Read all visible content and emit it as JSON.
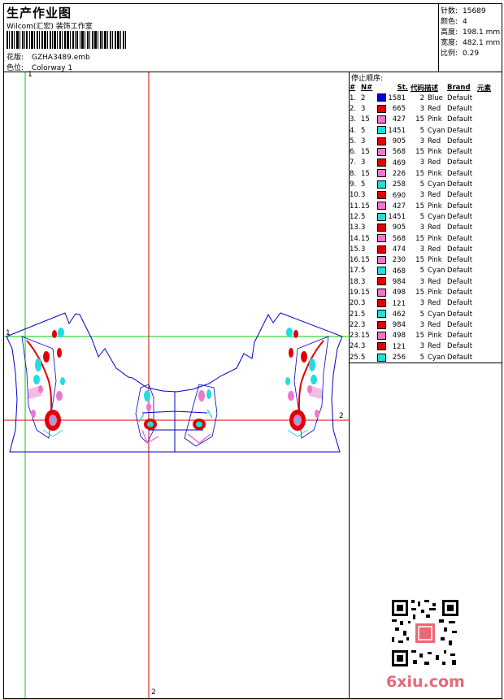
{
  "header": {
    "title": "生产作业图",
    "subtitle": "Wilcom(汇宏) 装饰工作室",
    "design_label": "花版:",
    "design_value": "GZHA3489.emb",
    "colorway_label": "色位:",
    "colorway_value": "Colorway 1"
  },
  "stats": [
    {
      "label": "针数:",
      "value": "15689"
    },
    {
      "label": "颜色:",
      "value": "4"
    },
    {
      "label": "高度:",
      "value": "198.1 mm"
    },
    {
      "label": "宽度:",
      "value": "482.1 mm"
    },
    {
      "label": "比例:",
      "value": "0.29"
    }
  ],
  "stop_sequence": {
    "title": "停止顺序:",
    "headers": [
      "#",
      "N#",
      "St.",
      "代码",
      "描述",
      "Brand",
      "元素"
    ],
    "rows": [
      [
        "1.",
        "2",
        "#0000dd",
        "1581",
        "2",
        "Blue",
        "Default"
      ],
      [
        "2.",
        "3",
        "#e00000",
        "665",
        "3",
        "Red",
        "Default"
      ],
      [
        "3.",
        "15",
        "#ee77cc",
        "427",
        "15",
        "Pink",
        "Default"
      ],
      [
        "4.",
        "5",
        "#22dddd",
        "1451",
        "5",
        "Cyan",
        "Default"
      ],
      [
        "5.",
        "3",
        "#e00000",
        "905",
        "3",
        "Red",
        "Default"
      ],
      [
        "6.",
        "15",
        "#ee77cc",
        "568",
        "15",
        "Pink",
        "Default"
      ],
      [
        "7.",
        "3",
        "#e00000",
        "469",
        "3",
        "Red",
        "Default"
      ],
      [
        "8.",
        "15",
        "#ee77cc",
        "226",
        "15",
        "Pink",
        "Default"
      ],
      [
        "9.",
        "5",
        "#22dddd",
        "258",
        "5",
        "Cyan",
        "Default"
      ],
      [
        "10.",
        "3",
        "#e00000",
        "690",
        "3",
        "Red",
        "Default"
      ],
      [
        "11.",
        "15",
        "#ee77cc",
        "427",
        "15",
        "Pink",
        "Default"
      ],
      [
        "12.",
        "5",
        "#22dddd",
        "1451",
        "5",
        "Cyan",
        "Default"
      ],
      [
        "13.",
        "3",
        "#e00000",
        "905",
        "3",
        "Red",
        "Default"
      ],
      [
        "14.",
        "15",
        "#ee77cc",
        "568",
        "15",
        "Pink",
        "Default"
      ],
      [
        "15.",
        "3",
        "#e00000",
        "474",
        "3",
        "Red",
        "Default"
      ],
      [
        "16.",
        "15",
        "#ee77cc",
        "230",
        "15",
        "Pink",
        "Default"
      ],
      [
        "17.",
        "5",
        "#22dddd",
        "468",
        "5",
        "Cyan",
        "Default"
      ],
      [
        "18.",
        "3",
        "#e00000",
        "984",
        "3",
        "Red",
        "Default"
      ],
      [
        "19.",
        "15",
        "#ee77cc",
        "498",
        "15",
        "Pink",
        "Default"
      ],
      [
        "20.",
        "3",
        "#e00000",
        "121",
        "3",
        "Red",
        "Default"
      ],
      [
        "21.",
        "5",
        "#22dddd",
        "462",
        "5",
        "Cyan",
        "Default"
      ],
      [
        "22.",
        "3",
        "#e00000",
        "984",
        "3",
        "Red",
        "Default"
      ],
      [
        "23.",
        "15",
        "#ee77cc",
        "498",
        "15",
        "Pink",
        "Default"
      ],
      [
        "24.",
        "3",
        "#e00000",
        "121",
        "3",
        "Red",
        "Default"
      ],
      [
        "25.",
        "5",
        "#22dddd",
        "256",
        "5",
        "Cyan",
        "Default"
      ]
    ]
  },
  "guides": {
    "v1_label": "1",
    "h1_label": "1",
    "v2_label": "2",
    "h2_label": "2"
  },
  "colors": {
    "guide_green": "#00cc00",
    "guide_red": "#dd0000",
    "outline_blue": "#0000cc",
    "thread_red": "#e00000",
    "thread_pink": "#ee77cc",
    "thread_cyan": "#22dddd",
    "watermark": "#e46a7a"
  },
  "watermark": {
    "text": "6xiu.com"
  }
}
